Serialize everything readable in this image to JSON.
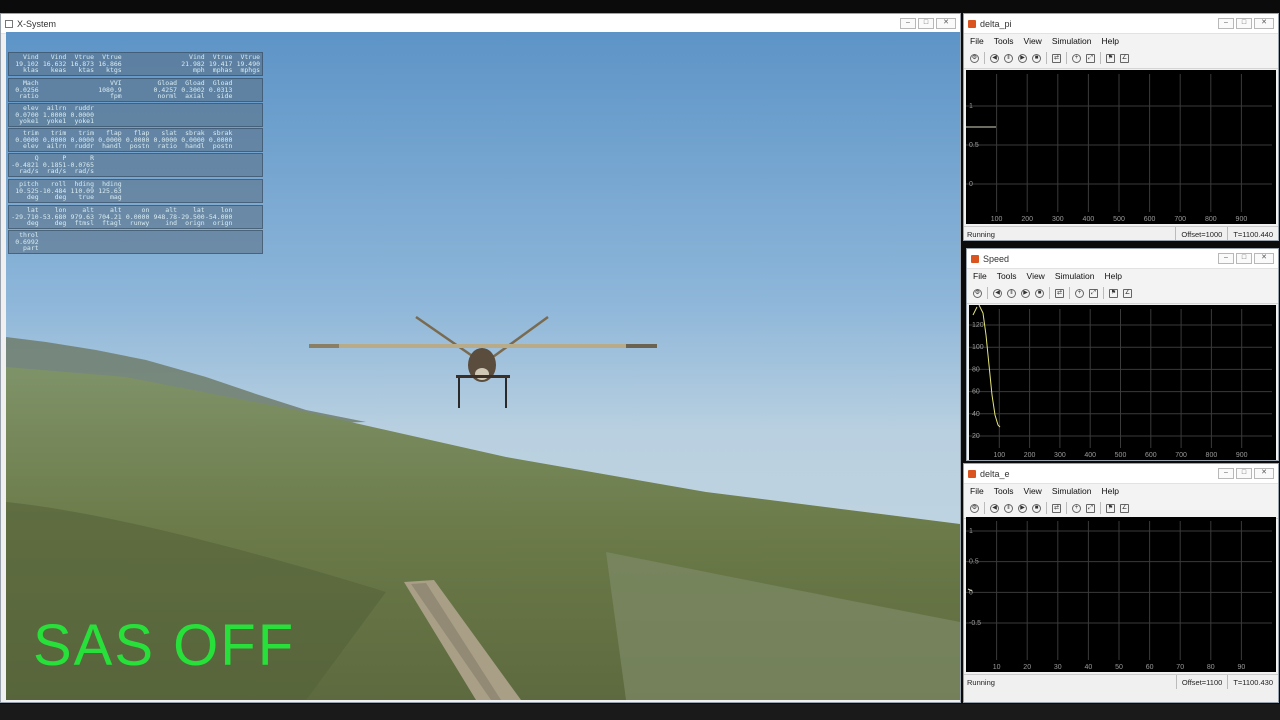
{
  "xsystem": {
    "title": "X-System",
    "overlay_text": "SAS OFF",
    "data_rows": [
      {
        "cells": [
          "Vind",
          "Vind",
          "Vtrue",
          "Vtrue",
          "",
          "",
          "Vind",
          "Vtrue",
          "Vtrue"
        ]
      },
      {
        "cells": [
          "19.102",
          "16.632",
          "16.873",
          "16.866",
          "",
          "",
          "21.982",
          "19.417",
          "19.490"
        ]
      },
      {
        "cells": [
          "klas",
          "keas",
          "ktas",
          "ktgs",
          "",
          "",
          "mph",
          "mphas",
          "mphgs"
        ]
      },
      {
        "cells": [
          "Mach",
          "",
          "",
          "VVI",
          "",
          "Gload",
          "Gload",
          "Gload",
          ""
        ]
      },
      {
        "cells": [
          "0.0256",
          "",
          "",
          "1080.9",
          "",
          "0.4257",
          "0.3002",
          "0.0313",
          ""
        ]
      },
      {
        "cells": [
          "ratio",
          "",
          "",
          "fpm",
          "",
          "norml",
          "axial",
          "side",
          ""
        ]
      },
      {
        "cells": [
          "elev",
          "ailrn",
          "ruddr",
          "",
          "",
          "",
          "",
          "",
          ""
        ]
      },
      {
        "cells": [
          "0.0700",
          "1.0000",
          "0.0000",
          "",
          "",
          "",
          "",
          "",
          ""
        ]
      },
      {
        "cells": [
          "yoke1",
          "yoke1",
          "yoke1",
          "",
          "",
          "",
          "",
          "",
          ""
        ]
      },
      {
        "cells": [
          "trim",
          "trim",
          "trim",
          "flap",
          "flap",
          "slat",
          "sbrak",
          "sbrak",
          ""
        ]
      },
      {
        "cells": [
          "0.0000",
          "0.0000",
          "0.0000",
          "0.0000",
          "0.0000",
          "0.0000",
          "0.0000",
          "0.0000",
          ""
        ]
      },
      {
        "cells": [
          "elev",
          "ailrn",
          "ruddr",
          "handl",
          "postn",
          "ratio",
          "handl",
          "postn",
          ""
        ]
      },
      {
        "cells": [
          "Q",
          "P",
          "R",
          "",
          "",
          "",
          "",
          "",
          ""
        ]
      },
      {
        "cells": [
          "-0.4821",
          "0.1851",
          "-0.0765",
          "",
          "",
          "",
          "",
          "",
          ""
        ]
      },
      {
        "cells": [
          "rad/s",
          "rad/s",
          "rad/s",
          "",
          "",
          "",
          "",
          "",
          ""
        ]
      },
      {
        "cells": [
          "pitch",
          "roll",
          "hding",
          "hding",
          "",
          "",
          "",
          "",
          ""
        ]
      },
      {
        "cells": [
          "10.525",
          "-10.484",
          "110.09",
          "125.63",
          "",
          "",
          "",
          "",
          ""
        ]
      },
      {
        "cells": [
          "deg",
          "deg",
          "true",
          "mag",
          "",
          "",
          "",
          "",
          ""
        ]
      },
      {
        "cells": [
          "lat",
          "lon",
          "alt",
          "alt",
          "on",
          "alt",
          "lat",
          "lon",
          ""
        ]
      },
      {
        "cells": [
          "-29.710",
          "-53.680",
          "979.63",
          "704.21",
          "0.0000",
          "948.78",
          "-29.500",
          "-54.000",
          ""
        ]
      },
      {
        "cells": [
          "deg",
          "deg",
          "ftmsl",
          "ftagl",
          "runwy",
          "ind",
          "orign",
          "orign",
          ""
        ]
      },
      {
        "cells": [
          "throl",
          "",
          "",
          "",
          "",
          "",
          "",
          "",
          ""
        ]
      },
      {
        "cells": [
          "0.6992",
          "",
          "",
          "",
          "",
          "",
          "",
          "",
          ""
        ]
      },
      {
        "cells": [
          "part",
          "",
          "",
          "",
          "",
          "",
          "",
          "",
          ""
        ]
      }
    ]
  },
  "scopes": [
    {
      "id": "delta_pi",
      "title": "delta_pi",
      "menu": [
        "File",
        "Tools",
        "View",
        "Simulation",
        "Help"
      ],
      "status": "Running",
      "offset": "Offset=1000",
      "time": "T=1100.440",
      "y_ticks": [
        "1",
        "0.5",
        "0"
      ],
      "x_ticks": [
        "100",
        "200",
        "300",
        "400",
        "500",
        "600",
        "700",
        "800",
        "900"
      ]
    },
    {
      "id": "speed",
      "title": "Speed",
      "menu": [
        "File",
        "Tools",
        "View",
        "Simulation",
        "Help"
      ],
      "status": "",
      "offset": "",
      "time": "",
      "y_ticks": [
        "120",
        "100",
        "80",
        "60",
        "40",
        "20"
      ],
      "x_ticks": [
        "100",
        "200",
        "300",
        "400",
        "500",
        "600",
        "700",
        "800",
        "900"
      ]
    },
    {
      "id": "delta_e",
      "title": "delta_e",
      "menu": [
        "File",
        "Tools",
        "View",
        "Simulation",
        "Help"
      ],
      "status": "Running",
      "offset": "Offset=1100",
      "time": "T=1100.430",
      "y_ticks": [
        "1",
        "0.5",
        "0",
        "-0.5"
      ],
      "x_ticks": [
        "10",
        "20",
        "30",
        "40",
        "50",
        "60",
        "70",
        "80",
        "90"
      ]
    }
  ],
  "colors": {
    "overlay_text": "#27e03a",
    "trace": "#e6e67a",
    "plot_bg": "#000000"
  }
}
